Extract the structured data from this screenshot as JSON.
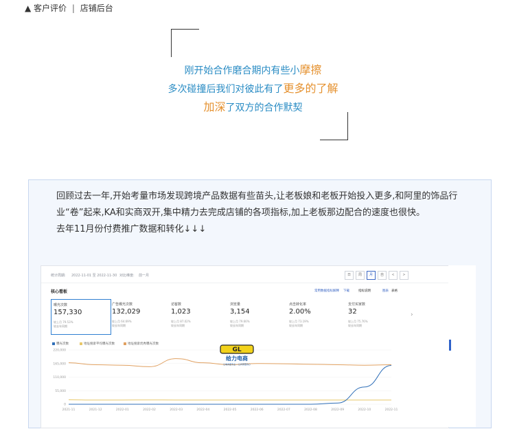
{
  "caption": {
    "prefix": "▲ 客户评价",
    "sep": "|",
    "suffix": "店铺后台"
  },
  "quote": {
    "line1_a": "刚开始合作磨合期内有些小",
    "line1_hl": "摩擦",
    "line2_a": "多次碰撞后我们对彼此有了",
    "line2_hl": "更多的了解",
    "line3_hl": "加深",
    "line3_b": "了双方的合作默契"
  },
  "paragraph": {
    "p1": "回顾过去一年,开始考量市场发现跨境产品数据有些苗头,让老板娘和老板开始投入更多,和阿里的饰品行业“卷”起来,KA和实商双开,集中精力去完成店铺的各项指标,加上老板那边配合的速度也很快。",
    "p2": "去年11月份付费推广数据和转化↓↓↓"
  },
  "dashboard": {
    "date_label": "统计周期:",
    "date_range": "2022-11-01 至 2022-11-30",
    "compare_label": "对比维度:",
    "compare_value": "前一月",
    "granularity": [
      "日",
      "周",
      "月",
      "自",
      "<",
      ">"
    ],
    "title": "核心看板",
    "tools": [
      "常用数据指标解释",
      "下载",
      "指标说明",
      "图表",
      "表格"
    ],
    "kpis": [
      {
        "label": "曝光次数",
        "value": "157,330",
        "change": "较上月 79.53%",
        "note": "较去年同期"
      },
      {
        "label": "广告曝光次数",
        "value": "132,029",
        "change": "较上月 64.69%",
        "note": "较去年同期"
      },
      {
        "label": "访客数",
        "value": "1,023",
        "change": "较上月 87.02%",
        "note": "较去年同期"
      },
      {
        "label": "浏览量",
        "value": "3,154",
        "change": "较上月 79.66%",
        "note": "较去年同期"
      },
      {
        "label": "点击转化率",
        "value": "2.00%",
        "change": "较上月 73.19%",
        "note": "较去年同期"
      },
      {
        "label": "支付买家数",
        "value": "32",
        "change": "较上月 75.76%",
        "note": "较去年同期"
      }
    ],
    "logo_text": "给力电商",
    "logo_sub": "让电商更专业 • 让商家更省心",
    "colors": {
      "series1": "#2f6fb8",
      "series2": "#e8c86a",
      "series3": "#e0a060",
      "accent": "#2f7fd1"
    }
  },
  "chart_data": {
    "type": "line",
    "x": [
      "2021-11",
      "2021-12",
      "2022-01",
      "2022-02",
      "2022-03",
      "2022-04",
      "2022-05",
      "2022-06",
      "2022-07",
      "2022-08",
      "2022-09",
      "2022-10",
      "2022-11"
    ],
    "yticks": [
      "220,000",
      "165,000",
      "110,000",
      "55,000",
      "0"
    ],
    "ylim": [
      0,
      220000
    ],
    "series": [
      {
        "name": "曝光次数",
        "color": "#2f6fb8",
        "values": [
          0,
          0,
          0,
          0,
          0,
          0,
          0,
          0,
          0,
          0,
          5000,
          70000,
          157330
        ]
      },
      {
        "name": "地址搜索平均曝光次数",
        "color": "#e8c86a",
        "values": [
          18000,
          17000,
          17000,
          17500,
          17000,
          17000,
          17000,
          17000,
          17000,
          17000,
          17000,
          17000,
          17000
        ]
      },
      {
        "name": "地址搜索优秀曝光次数",
        "color": "#e0a060",
        "values": [
          168000,
          160000,
          158000,
          152000,
          185000,
          168000,
          160000,
          165000,
          164000,
          162000,
          160000,
          158000,
          160000
        ]
      }
    ]
  }
}
